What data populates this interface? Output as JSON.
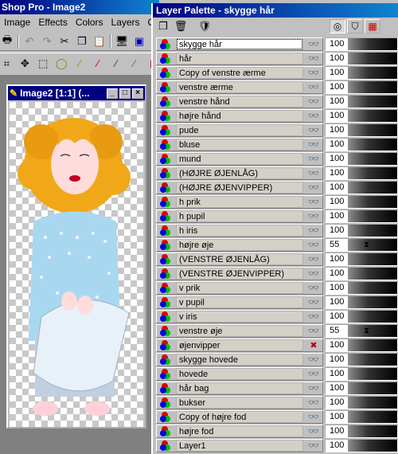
{
  "app": {
    "title": "Shop Pro - Image2",
    "menus": [
      "Image",
      "Effects",
      "Colors",
      "Layers",
      "O"
    ]
  },
  "image_window": {
    "title": "Image2 [1:1] (..."
  },
  "palette": {
    "title": "Layer Palette - skygge hår",
    "tools": [
      "new-layer-icon",
      "delete-layer-icon",
      "mask-icon"
    ],
    "tabs": [
      "opacity-tab",
      "mask-tab",
      "blend-tab"
    ],
    "layers": [
      {
        "name": "skygge hår",
        "visible": true,
        "opacity": "100",
        "selected": true
      },
      {
        "name": "hår",
        "visible": true,
        "opacity": "100"
      },
      {
        "name": "Copy of venstre ærme",
        "visible": true,
        "opacity": "100"
      },
      {
        "name": "venstre ærme",
        "visible": true,
        "opacity": "100"
      },
      {
        "name": "venstre hånd",
        "visible": true,
        "opacity": "100"
      },
      {
        "name": "højre hånd",
        "visible": true,
        "opacity": "100"
      },
      {
        "name": "pude",
        "visible": true,
        "opacity": "100"
      },
      {
        "name": "bluse",
        "visible": true,
        "opacity": "100"
      },
      {
        "name": "mund",
        "visible": true,
        "opacity": "100"
      },
      {
        "name": "(HØJRE ØJENLÅG)",
        "visible": true,
        "opacity": "100"
      },
      {
        "name": "(HØJRE ØJENVIPPER)",
        "visible": true,
        "opacity": "100"
      },
      {
        "name": "h prik",
        "visible": true,
        "opacity": "100"
      },
      {
        "name": "h pupil",
        "visible": true,
        "opacity": "100"
      },
      {
        "name": "h iris",
        "visible": true,
        "opacity": "100"
      },
      {
        "name": "højre øje",
        "visible": true,
        "opacity": "55",
        "partial": true
      },
      {
        "name": "(VENSTRE ØJENLÅG)",
        "visible": true,
        "opacity": "100"
      },
      {
        "name": "(VENSTRE ØJENVIPPER)",
        "visible": true,
        "opacity": "100"
      },
      {
        "name": "v prik",
        "visible": true,
        "opacity": "100"
      },
      {
        "name": "v pupil",
        "visible": true,
        "opacity": "100"
      },
      {
        "name": "v iris",
        "visible": true,
        "opacity": "100"
      },
      {
        "name": "venstre øje",
        "visible": true,
        "opacity": "55",
        "partial": true
      },
      {
        "name": "øjenvipper",
        "visible": false,
        "opacity": "100"
      },
      {
        "name": "skygge hovede",
        "visible": true,
        "opacity": "100"
      },
      {
        "name": "hovede",
        "visible": true,
        "opacity": "100"
      },
      {
        "name": "hår bag",
        "visible": true,
        "opacity": "100"
      },
      {
        "name": "bukser",
        "visible": true,
        "opacity": "100"
      },
      {
        "name": "Copy of højre fod",
        "visible": true,
        "opacity": "100"
      },
      {
        "name": "højre fod",
        "visible": true,
        "opacity": "100"
      },
      {
        "name": "Layer1",
        "visible": true,
        "opacity": "100"
      }
    ]
  },
  "colors": {
    "titlebar": "#000080",
    "hair": "#f0a818",
    "shirt": "#a8d8f0",
    "pants": "#c0d0e0"
  }
}
